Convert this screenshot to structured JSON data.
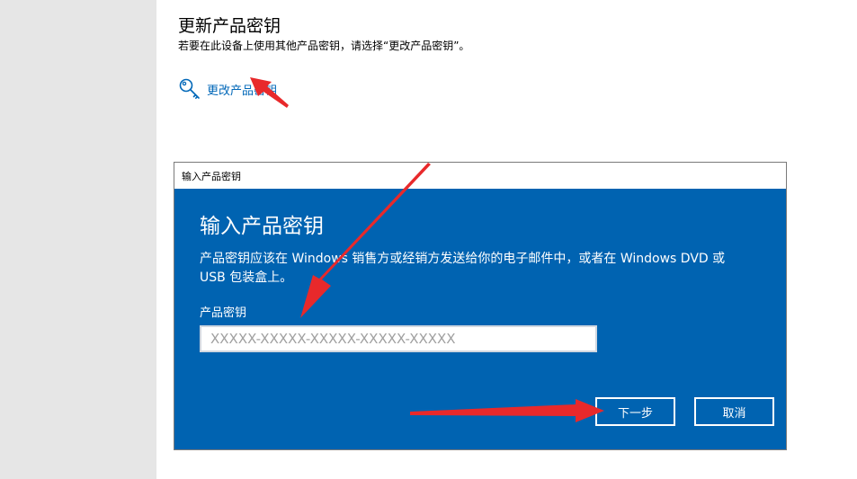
{
  "section": {
    "title": "更新产品密钥",
    "description": "若要在此设备上使用其他产品密钥，请选择“更改产品密钥”。",
    "change_link_label": "更改产品密钥",
    "link_icon": "key-icon"
  },
  "dialog": {
    "window_title": "输入产品密钥",
    "heading": "输入产品密钥",
    "description": "产品密钥应该在 Windows 销售方或经销方发送给你的电子邮件中，或者在 Windows DVD 或 USB 包装盒上。",
    "field_label": "产品密钥",
    "input_placeholder": "XXXXX-XXXXX-XXXXX-XXXXX-XXXXX",
    "input_value": "",
    "next_label": "下一步",
    "cancel_label": "取消"
  },
  "colors": {
    "dialog_bg": "#0063b1",
    "link": "#0067b8",
    "annotation_arrow": "#e8292b",
    "sidebar_bg": "#e6e6e6"
  }
}
